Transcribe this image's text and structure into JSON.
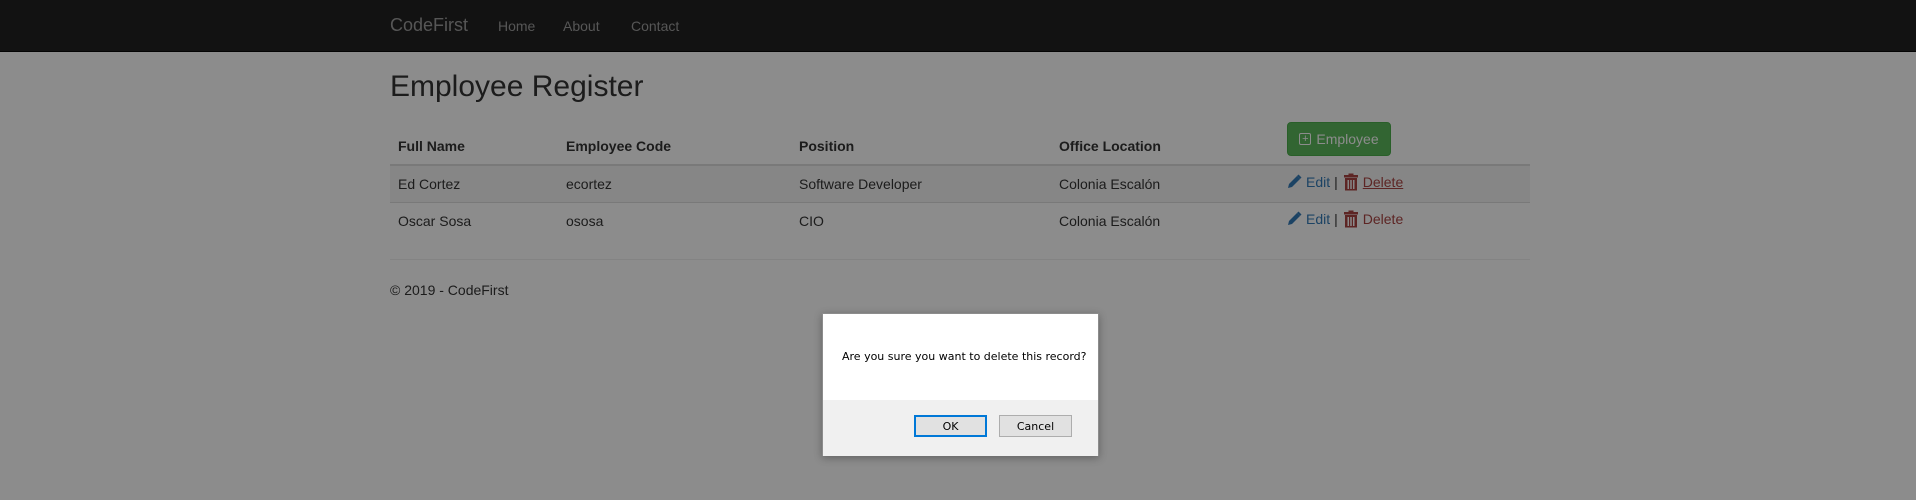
{
  "nav": {
    "brand": "CodeFirst",
    "links": [
      "Home",
      "About",
      "Contact"
    ]
  },
  "page": {
    "title": "Employee Register"
  },
  "table": {
    "headers": [
      "Full Name",
      "Employee Code",
      "Position",
      "Office Location"
    ],
    "add_button_label": "Employee",
    "rows": [
      {
        "full_name": "Ed Cortez",
        "code": "ecortez",
        "position": "Software Developer",
        "office": "Colonia Escalón",
        "edit": "Edit",
        "sep": "|",
        "delete": "Delete"
      },
      {
        "full_name": "Oscar Sosa",
        "code": "ososa",
        "position": "CIO",
        "office": "Colonia Escalón",
        "edit": "Edit",
        "sep": "|",
        "delete": "Delete"
      }
    ]
  },
  "footer": {
    "text": "© 2019 - CodeFirst"
  },
  "dialog": {
    "message": "Are you sure you want to delete this record?",
    "ok_label": "OK",
    "cancel_label": "Cancel"
  },
  "colors": {
    "navbar": "#222222",
    "success": "#5cb85c",
    "link": "#337ab7",
    "danger": "#a94442"
  },
  "icons": {
    "edit": "pencil-icon",
    "delete": "trash-icon",
    "add": "plus-square-icon"
  }
}
